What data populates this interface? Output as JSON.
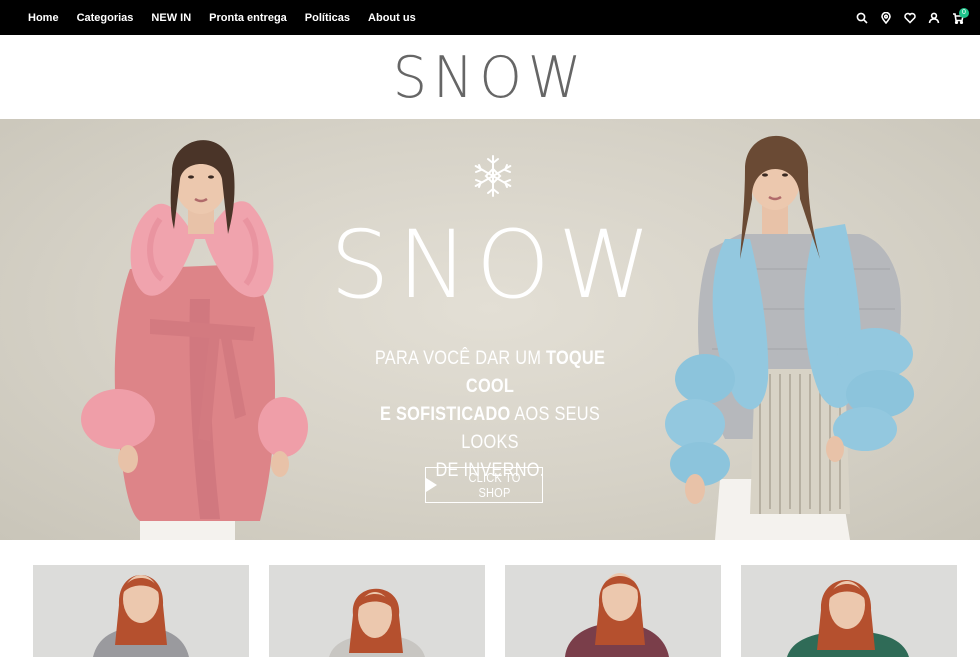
{
  "nav": {
    "items": [
      "Home",
      "Categorias",
      "NEW IN",
      "Pronta entrega",
      "Políticas",
      "About us"
    ]
  },
  "icons": [
    "search-icon",
    "location-icon",
    "heart-icon",
    "user-icon",
    "cart-icon"
  ],
  "cart": {
    "count": "0"
  },
  "header": {
    "logo": "SNOW"
  },
  "hero": {
    "logo": "SNOW",
    "tagline_line1_regular": "PARA VOCÊ DAR UM ",
    "tagline_line1_bold": "TOQUE COOL",
    "tagline_line2_bold": "E SOFISTICADO",
    "tagline_line2_regular": " AOS SEUS LOOKS",
    "tagline_line3": "DE INVERNO.",
    "cta_label": "CLICK TO SHOP"
  },
  "colors": {
    "topbar": "#000000",
    "hero_background": "#d6d2c7",
    "pink_coat": "#e0868a",
    "blue_fur": "#8fc6dd",
    "badge": "#1ec38a"
  },
  "products": [
    {
      "fur_color": "#9a9a9e"
    },
    {
      "fur_color": "#c8c6c2"
    },
    {
      "fur_color": "#7a3e4a"
    },
    {
      "fur_color": "#2f6b57"
    }
  ]
}
